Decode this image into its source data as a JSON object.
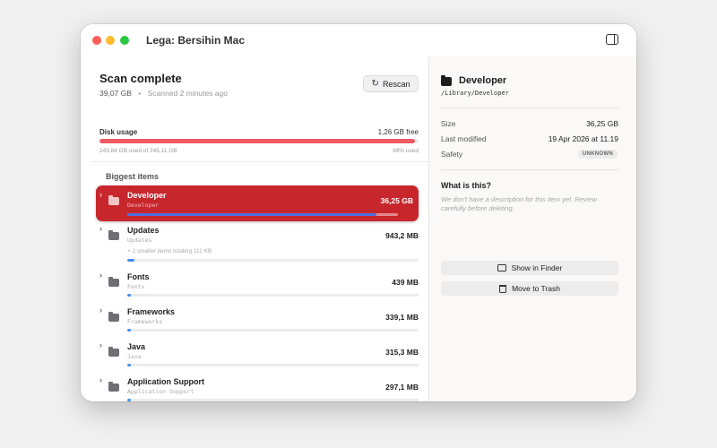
{
  "window": {
    "title": "Lega: Bersihin Mac"
  },
  "scan": {
    "title": "Scan complete",
    "total": "39,07 GB",
    "separator": "•",
    "scanned": "Scanned 2 minutes ago",
    "rescan_label": "Rescan"
  },
  "disk": {
    "label": "Disk usage",
    "free": "1,26 GB free",
    "used_text": "243,84 GB used of 245,11 GB",
    "percent_text": "99% used",
    "used_fraction": 0.99
  },
  "list": {
    "heading": "Biggest items",
    "items": [
      {
        "name": "Developer",
        "path": "Developer",
        "size": "36,25 GB",
        "fraction": 0.92,
        "selected": true
      },
      {
        "name": "Updates",
        "path": "Updates",
        "size": "943,2 MB",
        "fraction": 0.026,
        "note": "+ 2 smaller items totaling 111 KB"
      },
      {
        "name": "Fonts",
        "path": "Fonts",
        "size": "439 MB",
        "fraction": 0.012
      },
      {
        "name": "Frameworks",
        "path": "Frameworks",
        "size": "339,1 MB",
        "fraction": 0.009
      },
      {
        "name": "Java",
        "path": "Java",
        "size": "315,3 MB",
        "fraction": 0.009
      },
      {
        "name": "Application Support",
        "path": "Application Support",
        "size": "297,1 MB",
        "fraction": 0.008
      }
    ]
  },
  "detail": {
    "title": "Developer",
    "path": "/Library/Developer",
    "size_label": "Size",
    "size_value": "36,25 GB",
    "modified_label": "Last modified",
    "modified_value": "19 Apr 2026 at 11.19",
    "safety_label": "Safety",
    "safety_value": "UNKNOWN",
    "what_title": "What is this?",
    "what_desc": "We don't have a description for this item yet. Review carefully before deleting.",
    "show_in_finder": "Show in Finder",
    "move_to_trash": "Move to Trash"
  },
  "colors": {
    "selected_row": "#c8262d",
    "disk_bar": "#ee5a64",
    "item_bar": "#3e8ef7"
  }
}
